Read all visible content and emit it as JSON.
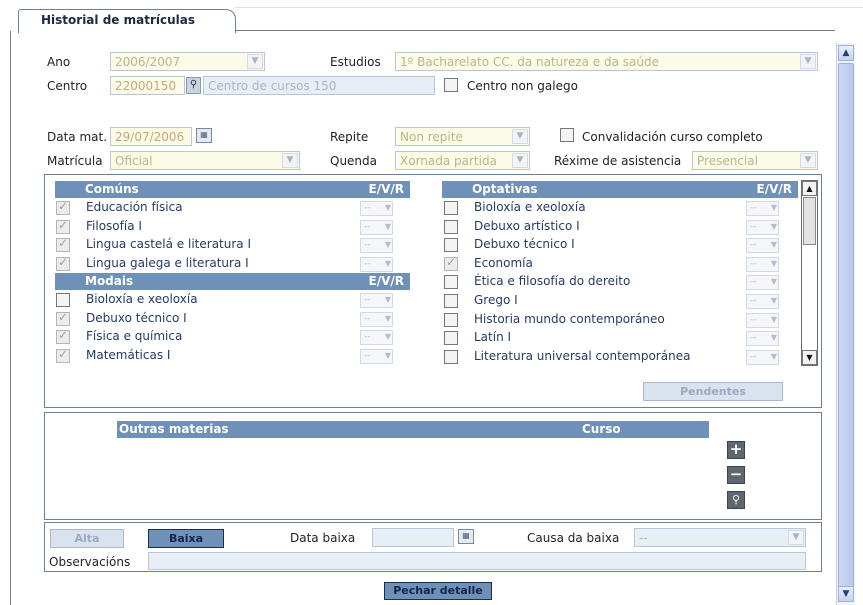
{
  "tab": {
    "title": "Historial de matrículas"
  },
  "form": {
    "ano_label": "Ano",
    "ano_value": "2006/2007",
    "estudios_label": "Estudios",
    "estudios_value": "1º Bacharelato CC. da natureza e da saúde",
    "centro_label": "Centro",
    "centro_code": "22000150",
    "centro_name": "Centro de cursos 150",
    "centro_non_galego_label": "Centro non galego",
    "data_mat_label": "Data mat.",
    "data_mat_value": "29/07/2006",
    "repite_label": "Repite",
    "repite_value": "Non repite",
    "convalidacion_label": "Convalidación curso completo",
    "matricula_label": "Matrícula",
    "matricula_value": "Oficial",
    "quenda_label": "Quenda",
    "quenda_value": "Xornada partida",
    "rexime_label": "Réxime de asistencia",
    "rexime_value": "Presencial"
  },
  "subjects": {
    "ev_header": "E/V/R",
    "dash": "--",
    "comuns_title": "Comúns",
    "comuns": [
      {
        "name": "Educación física",
        "checked": true
      },
      {
        "name": "Filosofía I",
        "checked": true
      },
      {
        "name": "Lingua castelá e literatura I",
        "checked": true
      },
      {
        "name": "Lingua galega e literatura I",
        "checked": true
      }
    ],
    "modais_title": "Modais",
    "modais": [
      {
        "name": "Bioloxía e xeoloxía",
        "checked": false
      },
      {
        "name": "Debuxo técnico I",
        "checked": true
      },
      {
        "name": "Física e química",
        "checked": true
      },
      {
        "name": "Matemáticas I",
        "checked": true
      }
    ],
    "optativas_title": "Optativas",
    "optativas": [
      {
        "name": "Bioloxía e xeoloxía",
        "checked": false
      },
      {
        "name": "Debuxo artístico I",
        "checked": false
      },
      {
        "name": "Debuxo técnico I",
        "checked": false
      },
      {
        "name": "Economía",
        "checked": true
      },
      {
        "name": "Ética e filosofía do dereito",
        "checked": false
      },
      {
        "name": "Grego I",
        "checked": false
      },
      {
        "name": "Historia mundo contemporáneo",
        "checked": false
      },
      {
        "name": "Latín I",
        "checked": false
      },
      {
        "name": "Literatura universal contemporánea",
        "checked": false
      }
    ],
    "pendentes_label": "Pendentes"
  },
  "outras": {
    "materias_header": "Outras materias",
    "curso_header": "Curso"
  },
  "baixa": {
    "alta_label": "Alta",
    "baixa_label": "Baixa",
    "data_baixa_label": "Data baixa",
    "data_baixa_value": "",
    "causa_label": "Causa da baixa",
    "causa_value": "--",
    "observacions_label": "Observacións",
    "observacions_value": ""
  },
  "footer": {
    "pechar_label": "Pechar detalle"
  }
}
